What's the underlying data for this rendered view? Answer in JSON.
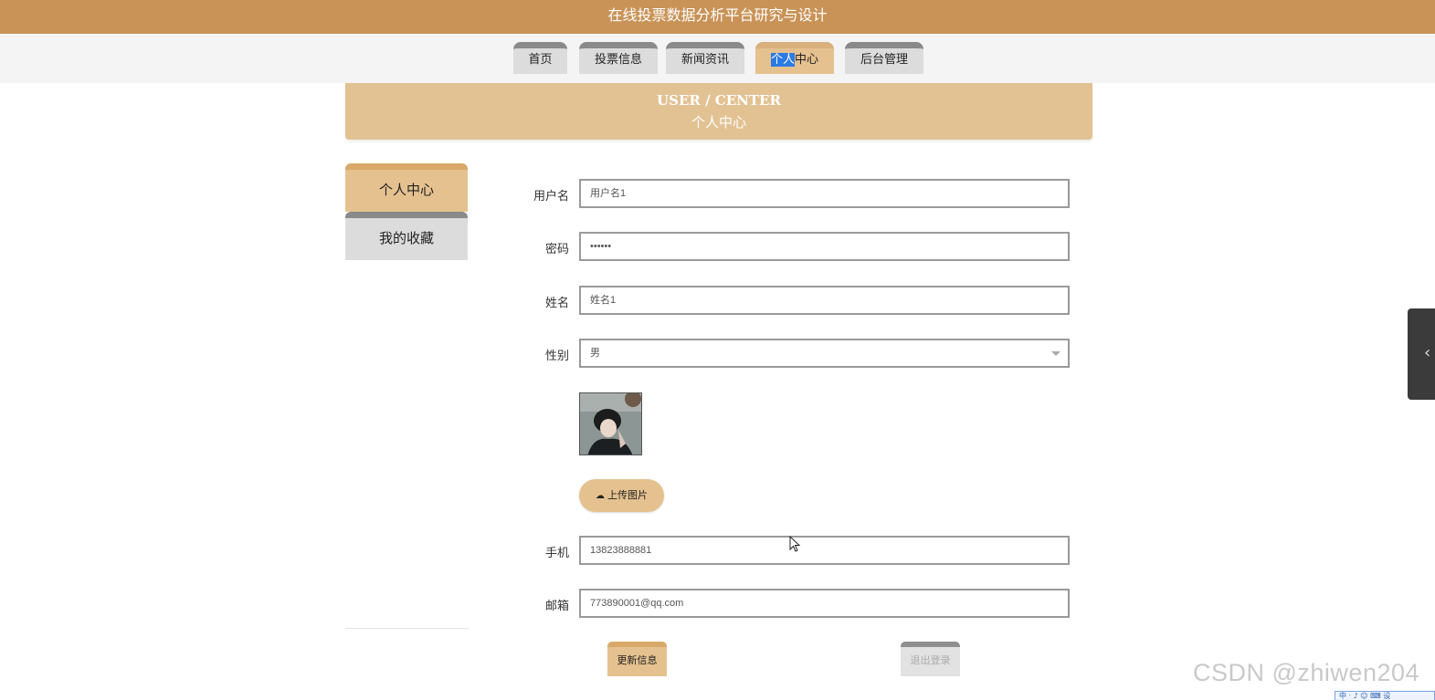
{
  "app_title": "在线投票数据分析平台研究与设计",
  "nav": {
    "items": [
      {
        "label": "首页"
      },
      {
        "label": "投票信息"
      },
      {
        "label": "新闻资讯"
      },
      {
        "label_hl": "个人",
        "label_rest": "中心",
        "active": true
      },
      {
        "label": "后台管理"
      }
    ]
  },
  "banner": {
    "en": "USER / CENTER",
    "zh": "个人中心"
  },
  "sidebar": {
    "items": [
      {
        "label": "个人中心",
        "active": true
      },
      {
        "label": "我的收藏"
      }
    ]
  },
  "form": {
    "username": {
      "label": "用户名",
      "value": "用户名1"
    },
    "password": {
      "label": "密码",
      "value": "••••••"
    },
    "name": {
      "label": "姓名",
      "value": "姓名1"
    },
    "gender": {
      "label": "性别",
      "value": "男"
    },
    "upload_label": "上传图片",
    "phone": {
      "label": "手机",
      "value": "13823888881"
    },
    "email": {
      "label": "邮箱",
      "value": "773890001@qq.com"
    }
  },
  "actions": {
    "update": "更新信息",
    "logout": "退出登录"
  },
  "watermark": "CSDN @zhiwen204",
  "ime": "中 · ♪ ☺ ⌨ 设",
  "colors": {
    "topbar": "#c99357",
    "accent": "#e5c18f",
    "inactive_tab": "#dcdcdc"
  },
  "icons": {
    "upload": "cloud-upload-icon",
    "side_tab": "chevron-left-icon",
    "select": "chevron-down-icon"
  }
}
